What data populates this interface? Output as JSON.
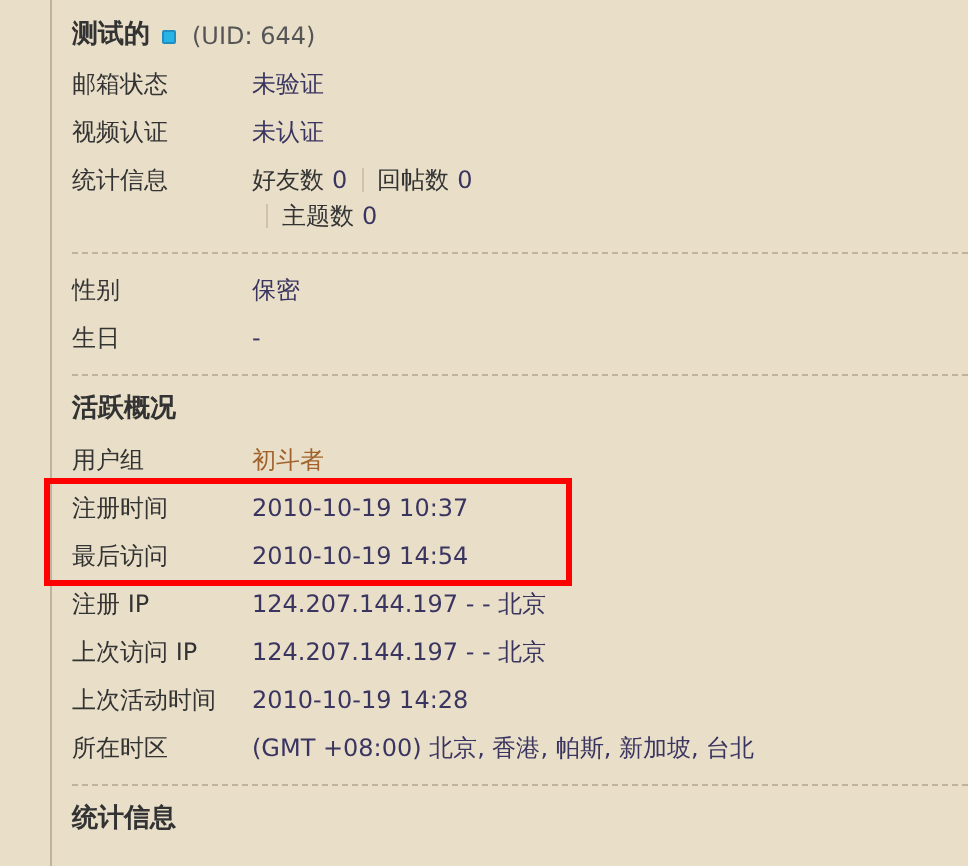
{
  "profile": {
    "name": "测试的",
    "uid": "(UID: 644)"
  },
  "sections": [
    {
      "rows": [
        {
          "label": "邮箱状态",
          "kind": "text",
          "value": "未验证",
          "highlighted": false
        },
        {
          "label": "视频认证",
          "kind": "text",
          "value": "未认证",
          "highlighted": false
        },
        {
          "label": "统计信息",
          "kind": "stats",
          "stats": [
            {
              "label": "好友数",
              "value": "0"
            },
            {
              "label": "回帖数",
              "value": "0"
            },
            {
              "label": "主题数",
              "value": "0"
            }
          ],
          "highlighted": false
        }
      ]
    },
    {
      "rows": [
        {
          "label": "性别",
          "kind": "text",
          "value": "保密",
          "highlighted": false
        },
        {
          "label": "生日",
          "kind": "text",
          "value": "-",
          "highlighted": false
        }
      ]
    },
    {
      "title": "活跃概况",
      "rows": [
        {
          "label": "用户组",
          "kind": "link",
          "value": "初斗者",
          "highlighted": false
        },
        {
          "label": "注册时间",
          "kind": "text",
          "value": "2010-10-19 10:37",
          "highlighted": true
        },
        {
          "label": "最后访问",
          "kind": "text",
          "value": "2010-10-19 14:54",
          "highlighted": true
        },
        {
          "label": "注册 IP",
          "kind": "text",
          "value": "124.207.144.197 - - 北京",
          "highlighted": false
        },
        {
          "label": "上次访问 IP",
          "kind": "text",
          "value": "124.207.144.197 - - 北京",
          "highlighted": false
        },
        {
          "label": "上次活动时间",
          "kind": "text",
          "value": "2010-10-19 14:28",
          "highlighted": false
        },
        {
          "label": "所在时区",
          "kind": "text",
          "value": "(GMT +08:00) 北京, 香港, 帕斯, 新加坡, 台北",
          "highlighted": false
        }
      ]
    },
    {
      "title": "统计信息"
    }
  ]
}
